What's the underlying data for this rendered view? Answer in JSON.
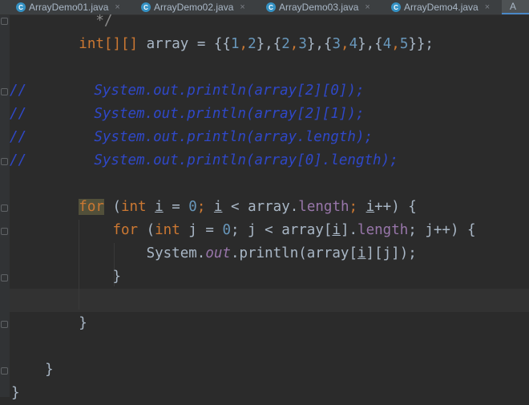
{
  "tabs": [
    {
      "label": "ArrayDemo01.java",
      "active": false
    },
    {
      "label": "ArrayDemo02.java",
      "active": false
    },
    {
      "label": "ArrayDemo03.java",
      "active": false
    },
    {
      "label": "ArrayDemo4.java",
      "active": false
    },
    {
      "label": "A",
      "active": true
    }
  ],
  "tab_icon_glyph": "C",
  "tab_close_glyph": "×",
  "colors": {
    "keyword": "#cc7832",
    "number": "#6897bb",
    "field": "#9876aa",
    "comment": "#2f48c9",
    "text": "#a9b7c6",
    "background": "#2b2b2b"
  },
  "code": {
    "comment_close": "*/",
    "decl": {
      "type": "int[][]",
      "rest": " array = {{",
      "n1": "1",
      "c1": ",",
      "n2": "2",
      "s1": "},{",
      "n3": "2",
      "c2": ",",
      "n4": "3",
      "s2": "},{",
      "n5": "3",
      "c3": ",",
      "n6": "4",
      "s3": "},{",
      "n7": "4",
      "c4": ",",
      "n8": "5",
      "end": "}};"
    },
    "commented": [
      "//        System.out.println(array[2][0]);",
      "//        System.out.println(array[2][1]);",
      "//        System.out.println(array.length);",
      "//        System.out.println(array[0].length);"
    ],
    "outer_for": {
      "kw": "for",
      "p1": " (",
      "type": "int",
      "sp": " ",
      "var1": "i",
      "eq": " = ",
      "zero": "0",
      "semi1": "; ",
      "var2": "i",
      "lt": " < array.",
      "length": "length",
      "semi2": "; ",
      "var3": "i",
      "inc": "++) {"
    },
    "inner_for": {
      "kw": "for",
      "p1": " (",
      "type": "int",
      "sp": " ",
      "var1": "j",
      "eq": " = ",
      "zero": "0",
      "semi1": "; j < array[",
      "idx": "i",
      "dot": "].",
      "length": "length",
      "semi2": "; j++) {"
    },
    "print": {
      "pre": "System.",
      "out": "out",
      "mid": ".println(array[",
      "idx": "i",
      "post": "][j]);"
    },
    "close_inner": "}",
    "close_outer": "}",
    "close_method": "}",
    "close_class": "}"
  }
}
